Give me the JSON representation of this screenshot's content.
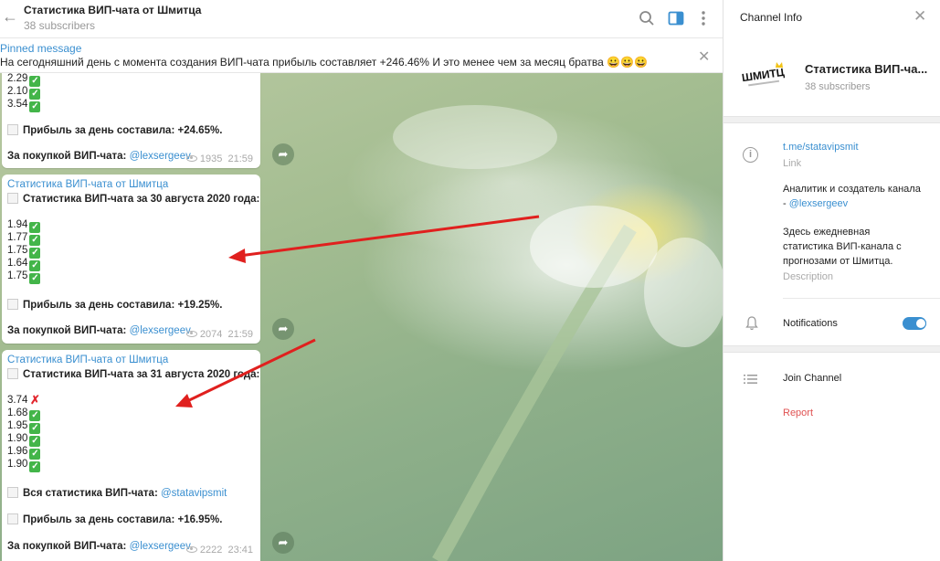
{
  "header": {
    "title": "Статистика ВИП-чата от Шмитца",
    "subtitle": "38 subscribers"
  },
  "pinned": {
    "title": "Pinned message",
    "text": "На сегодняшний день с момента создания ВИП-чата прибыль составляет +246.46%  И это менее чем за месяц братва 😀😀😀"
  },
  "messages": [
    {
      "values": [
        "2.29",
        "2.10",
        "3.54"
      ],
      "profit": "Прибыль за день составила: +24.65%.",
      "buy_label": "За покупкой ВИП-чата:",
      "buy_link": "@lexsergeev",
      "views": "1935",
      "time": "21:59"
    },
    {
      "author": "Статистика ВИП-чата от Шмитца",
      "heading": "Статистика ВИП-чата за 30 августа 2020 года:",
      "values": [
        "1.94",
        "1.77",
        "1.75",
        "1.64",
        "1.75"
      ],
      "profit": "Прибыль за день составила: +19.25%.",
      "buy_label": "За покупкой ВИП-чата:",
      "buy_link": "@lexsergeev",
      "views": "2074",
      "time": "21:59"
    },
    {
      "author": "Статистика ВИП-чата от Шмитца",
      "heading": "Статистика ВИП-чата за 31 августа 2020 года:",
      "values": [
        "3.74",
        "1.68",
        "1.95",
        "1.90",
        "1.96",
        "1.90"
      ],
      "marks": [
        "cross",
        "check",
        "check",
        "check",
        "check",
        "check"
      ],
      "all_stats_label": "Вся статистика ВИП-чата:",
      "all_stats_link": "@statavipsmit",
      "profit": "Прибыль за день составила: +16.95%.",
      "buy_label": "За покупкой ВИП-чата:",
      "buy_link": "@lexsergeev",
      "views": "2222",
      "time": "23:41"
    }
  ],
  "panel": {
    "title": "Channel Info",
    "logo_text": "ШМИТЦ",
    "channel_name": "Статистика ВИП-ча...",
    "subscribers": "38 subscribers",
    "link": "t.me/statavipsmit",
    "link_caption": "Link",
    "desc_line1": "Аналитик и создатель канала",
    "desc_line2_prefix": "- ",
    "desc_line2_link": "@lexsergeev",
    "desc_line3": "Здесь ежедневная",
    "desc_line4": "статистика ВИП-канала с",
    "desc_line5": "прогнозами от Шмитца.",
    "desc_caption": "Description",
    "notifications_label": "Notifications",
    "notifications_on": true,
    "join_label": "Join Channel",
    "report_label": "Report"
  },
  "colors": {
    "accent": "#3a8fd0",
    "check": "#43b549",
    "cross": "#e2262d",
    "arrow": "#e0201e",
    "report": "#e05252"
  }
}
